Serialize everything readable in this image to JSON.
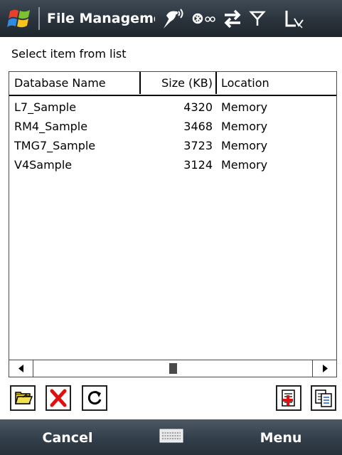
{
  "window": {
    "title": "File Manageme",
    "tray_icons": [
      "antenna-icon",
      "bluetooth-icon",
      "sync-arrows-icon",
      "signal-icon",
      "battery-icon"
    ]
  },
  "prompt_label": "Select item from list",
  "list": {
    "columns": [
      "Database Name",
      "Size (KB)",
      "Location"
    ],
    "rows": [
      {
        "name": "L7_Sample",
        "size": "4320",
        "location": "Memory"
      },
      {
        "name": "RM4_Sample",
        "size": "3468",
        "location": "Memory"
      },
      {
        "name": "TMG7_Sample",
        "size": "3723",
        "location": "Memory"
      },
      {
        "name": "V4Sample",
        "size": "3124",
        "location": "Memory"
      }
    ],
    "scroll_position": 0.5
  },
  "toolbar": {
    "left_buttons": [
      "open-folder-icon",
      "delete-icon",
      "refresh-icon"
    ],
    "right_buttons": [
      "new-database-icon",
      "copy-icon"
    ]
  },
  "softkeys": {
    "left": "Cancel",
    "right": "Menu",
    "center_icon": "keyboard-icon"
  },
  "colors": {
    "titlebar": "#2a333c",
    "softbar": "#34404b",
    "delete_red": "#e01010"
  }
}
